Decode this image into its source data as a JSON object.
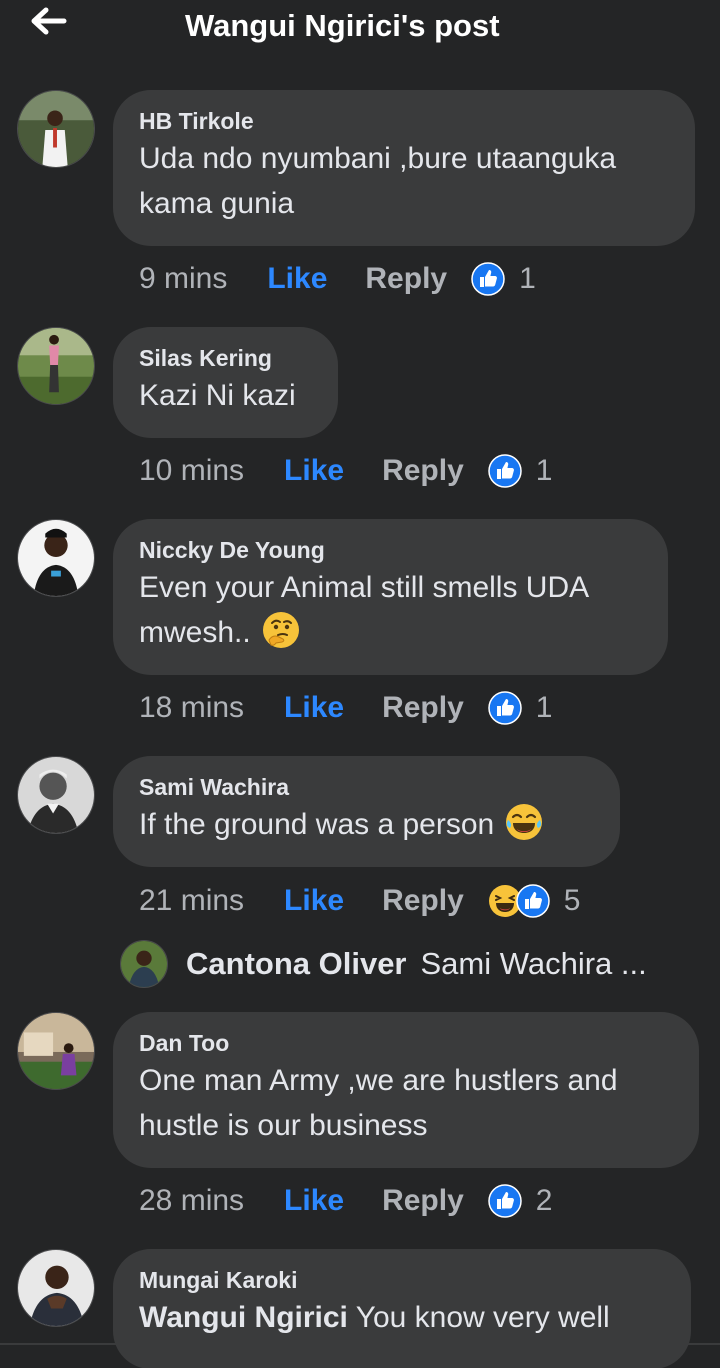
{
  "header": {
    "title": "Wangui Ngirici's post",
    "back_icon": "arrow-left-icon"
  },
  "colors": {
    "background": "#242526",
    "bubble": "#3a3b3c",
    "like_blue": "#2d88ff",
    "muted": "#b0b3b8",
    "text": "#e4e6eb"
  },
  "comments": [
    {
      "author": "HB Tirkole",
      "text": "Uda ndo nyumbani ,bure utaanguka kama gunia",
      "time": "9 mins",
      "like_label": "Like",
      "reply_label": "Reply",
      "reactions": [
        "like-reaction-icon"
      ],
      "reaction_count": "1"
    },
    {
      "author": "Silas Kering",
      "text": "Kazi Ni kazi",
      "time": "10 mins",
      "like_label": "Like",
      "reply_label": "Reply",
      "reactions": [
        "like-reaction-icon"
      ],
      "reaction_count": "1"
    },
    {
      "author": "Niccky De Young",
      "text": "Even your Animal still smells UDA mwesh..",
      "emoji": "thinking-face-icon",
      "time": "18 mins",
      "like_label": "Like",
      "reply_label": "Reply",
      "reactions": [
        "like-reaction-icon"
      ],
      "reaction_count": "1"
    },
    {
      "author": "Sami Wachira",
      "text": "If the ground was a person",
      "emoji": "tears-of-joy-icon",
      "time": "21 mins",
      "like_label": "Like",
      "reply_label": "Reply",
      "reactions": [
        "haha-reaction-icon",
        "like-reaction-icon"
      ],
      "reaction_count": "5",
      "reply_preview": {
        "author": "Cantona Oliver",
        "text": "Sami Wachira ..."
      }
    },
    {
      "author": "Dan Too",
      "text": "One man Army ,we are hustlers and hustle is our business",
      "time": "28 mins",
      "like_label": "Like",
      "reply_label": "Reply",
      "reactions": [
        "like-reaction-icon"
      ],
      "reaction_count": "2"
    },
    {
      "author": "Mungai Karoki",
      "mention": "Wangui Ngirici",
      "text": "You know very well"
    }
  ]
}
